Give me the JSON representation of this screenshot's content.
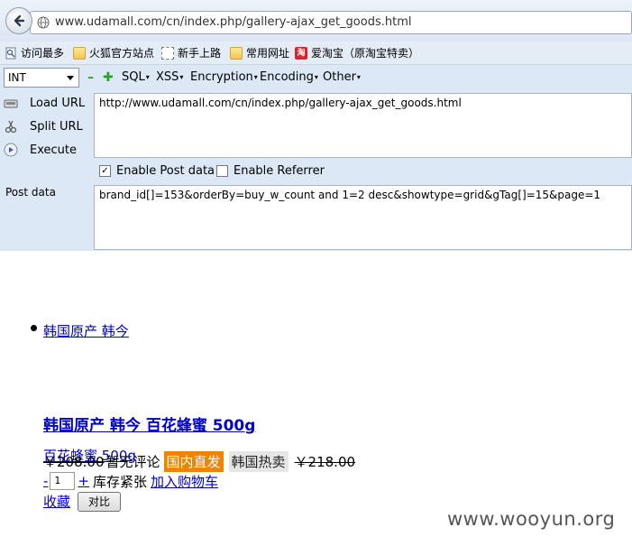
{
  "address_bar": {
    "url": "www.udamall.com/cn/index.php/gallery-ajax_get_goods.html"
  },
  "bookmarks": [
    {
      "label": "访问最多",
      "icon": "page-icon"
    },
    {
      "label": "火狐官方站点",
      "icon": "folder-icon"
    },
    {
      "label": "新手上路",
      "icon": "dotted-box-icon"
    },
    {
      "label": "常用网址",
      "icon": "folder-icon"
    },
    {
      "label": "爱淘宝（原淘宝特卖）",
      "icon": "taobao-icon",
      "icon_text": "淘"
    }
  ],
  "hackbar": {
    "type_select": "INT",
    "menus": [
      "SQL",
      "XSS",
      "Encryption",
      "Encoding",
      "Other"
    ],
    "buttons": {
      "load": "Load URL",
      "split": "Split URL",
      "execute": "Execute"
    },
    "url_value": "http://www.udamall.com/cn/index.php/gallery-ajax_get_goods.html",
    "enable_post": {
      "label": "Enable Post data",
      "checked": true
    },
    "enable_referrer": {
      "label": "Enable Referrer",
      "checked": false
    },
    "post_label": "Post data",
    "post_value": "brand_id[]=153&orderBy=buy_w_count  and 1=2 desc&showtype=grid&gTag[]=15&page=1"
  },
  "page": {
    "brand_link": "韩国原产 韩今",
    "product_title": "韩国原产 韩今 百花蜂蜜 500g",
    "product_sub": "百花蜂蜜 500g",
    "price": "￥208.00",
    "reviews": "暂无评论",
    "tag_domestic": "国内直发",
    "tag_hot": "韩国热卖",
    "old_price": "￥218.00",
    "qty_minus": "-",
    "qty_value": "1",
    "qty_plus": "+",
    "stock": "库存紧张",
    "add_cart": "加入购物车",
    "favorite": "收藏",
    "compare": "对比"
  },
  "watermark": "www.wooyun.org",
  "colors": {
    "link": "#0000cc",
    "tag_domestic_bg": "#f08300",
    "hackbar_bg": "#dce8f5"
  }
}
